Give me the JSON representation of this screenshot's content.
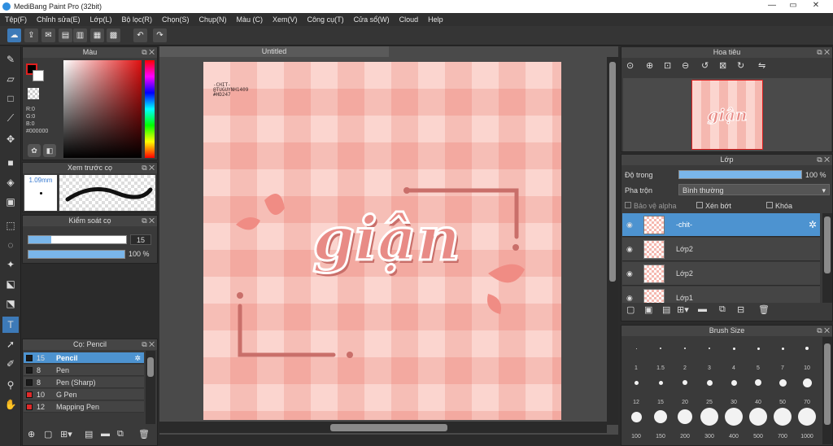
{
  "window": {
    "title": "MediBang Paint Pro (32bit)",
    "minimize": "—",
    "maximize": "▭",
    "close": "✕"
  },
  "menu": [
    "Tệp(F)",
    "Chỉnh sửa(E)",
    "Lớp(L)",
    "Bộ lọc(R)",
    "Chọn(S)",
    "Chụp(N)",
    "Màu (C)",
    "Xem(V)",
    "Công cụ(T)",
    "Cửa sổ(W)",
    "Cloud",
    "Help"
  ],
  "colors": {
    "accent": "#4d93d0",
    "canvas_bg": "#f8c9c2",
    "check_a": "#f5b8b0",
    "check_b": "#fbd5cf",
    "text_fill": "#e88b86",
    "frame": "#c96f6a"
  },
  "color_panel": {
    "title": "Màu",
    "r": "R:0",
    "g": "G:0",
    "b": "B:0",
    "hex": "#000000"
  },
  "brush_preview": {
    "title": "Xem trước cọ",
    "size": "1.09mm"
  },
  "brush_control": {
    "title": "Kiểm soát cọ",
    "size_value": "15",
    "opacity_value": "100 %",
    "size_fraction": 0.23,
    "opacity_fraction": 1.0
  },
  "brush_list": {
    "title": "Cọ: Pencil",
    "items": [
      {
        "size": "15",
        "name": "Pencil",
        "selected": true,
        "color": "#1a1a1a"
      },
      {
        "size": "8",
        "name": "Pen",
        "selected": false,
        "color": "#1a1a1a"
      },
      {
        "size": "8",
        "name": "Pen (Sharp)",
        "selected": false,
        "color": "#1a1a1a"
      },
      {
        "size": "10",
        "name": "G Pen",
        "selected": false,
        "color": "#e02a2a"
      },
      {
        "size": "12",
        "name": "Mapping Pen",
        "selected": false,
        "color": "#e02a2a"
      }
    ]
  },
  "canvas": {
    "tab": "Untitled",
    "credit_line1": "-CHIT-",
    "credit_line2": "@TUGUYNH1409",
    "credit_line3": "#HD247",
    "word": "giận"
  },
  "navigator": {
    "title": "Hoa tiêu"
  },
  "layers": {
    "title": "Lớp",
    "opacity_label": "Độ trong",
    "opacity_value": "100 %",
    "opacity_fraction": 1.0,
    "blend_label": "Pha trộn",
    "blend_value": "Bình thường",
    "protect_alpha": "Bảo vệ alpha",
    "clip": "Xén bớt",
    "lock": "Khóa",
    "items": [
      {
        "name": "-chit-",
        "selected": true
      },
      {
        "name": "Lớp2",
        "selected": false
      },
      {
        "name": "Lớp2",
        "selected": false
      },
      {
        "name": "Lớp1",
        "selected": false
      }
    ]
  },
  "brush_size": {
    "title": "Brush Size",
    "sizes": [
      "1",
      "1.5",
      "2",
      "3",
      "4",
      "5",
      "7",
      "10",
      "12",
      "15",
      "20",
      "25",
      "30",
      "40",
      "50",
      "70",
      "100",
      "150",
      "200",
      "300",
      "400",
      "500",
      "700",
      "1000"
    ]
  }
}
